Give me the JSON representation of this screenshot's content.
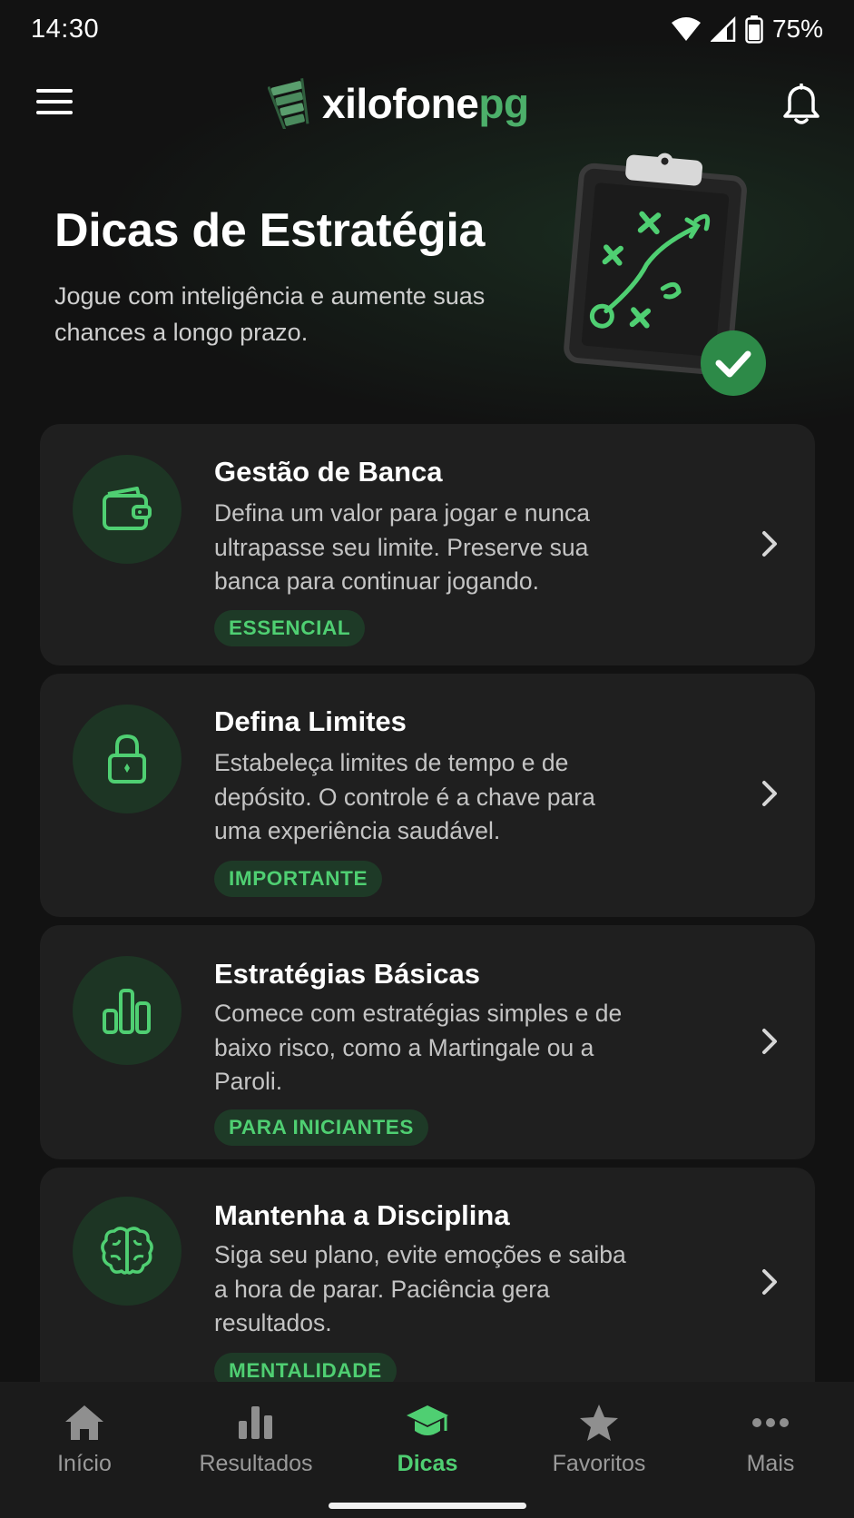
{
  "status_bar": {
    "time": "14:30",
    "battery": "75%"
  },
  "app_bar": {
    "logo_main": "xilofone",
    "logo_accent": "pg"
  },
  "hero": {
    "title": "Dicas de Estratégia",
    "subtitle": "Jogue com inteligência e aumente suas chances a longo prazo."
  },
  "cards": [
    {
      "title": "Gestão de Banca",
      "desc": "Defina um valor para jogar e nunca ultrapasse seu limite. Preserve sua banca para continuar jogando.",
      "tag": "ESSENCIAL",
      "icon": "wallet-icon"
    },
    {
      "title": "Defina Limites",
      "desc": "Estabeleça limites de tempo e de depósito. O controle é a chave para uma experiência saudável.",
      "tag": "IMPORTANTE",
      "icon": "lock-icon"
    },
    {
      "title": "Estratégias Básicas",
      "desc": "Comece com estratégias simples e de baixo risco, como a Martingale ou a Paroli.",
      "tag": "PARA INICIANTES",
      "icon": "bar-chart-icon"
    },
    {
      "title": "Mantenha a Disciplina",
      "desc": "Siga seu plano, evite emoções e saiba a hora de parar. Paciência gera resultados.",
      "tag": "MENTALIDADE",
      "icon": "brain-icon"
    }
  ],
  "bottom_nav": {
    "items": [
      {
        "label": "Início",
        "icon": "home-icon"
      },
      {
        "label": "Resultados",
        "icon": "bar-chart-icon"
      },
      {
        "label": "Dicas",
        "icon": "graduation-cap-icon",
        "active": true
      },
      {
        "label": "Favoritos",
        "icon": "star-icon"
      },
      {
        "label": "Mais",
        "icon": "more-icon"
      }
    ]
  },
  "colors": {
    "accent": "#4fcf72",
    "background": "#121212",
    "card": "#1f1f1f"
  }
}
